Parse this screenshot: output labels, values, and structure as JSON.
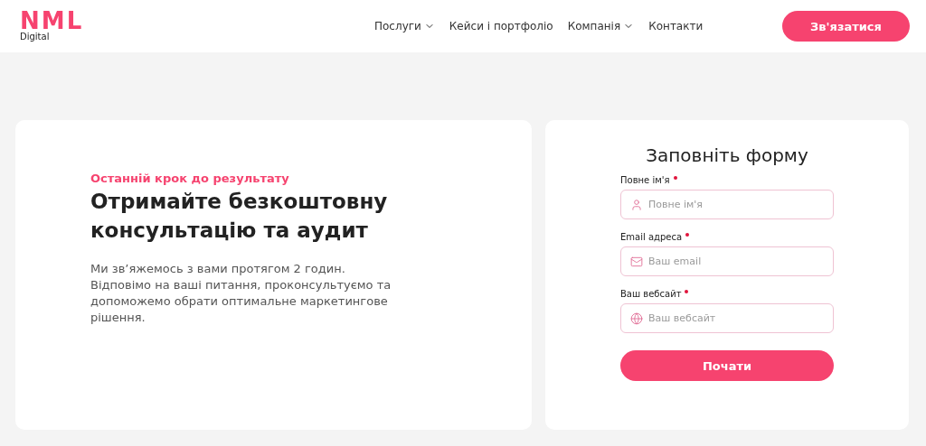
{
  "header": {
    "logo": {
      "mark": "NML",
      "sub": "Digital"
    },
    "nav": [
      {
        "label": "Послуги",
        "dropdown": true
      },
      {
        "label": "Кейси і портфоліо",
        "dropdown": false
      },
      {
        "label": "Компанія",
        "dropdown": true
      },
      {
        "label": "Контакти",
        "dropdown": false
      }
    ],
    "cta": "Зв'язатися"
  },
  "intro": {
    "eyebrow": "Останній крок до результату",
    "title": "Отримайте безкоштовну консультацію та аудит",
    "text": "Ми зв’яжемось з вами протягом 2 годин. Відповімо на ваші питання, проконсультуємо та допоможемо обрати оптимальне маркетингове рішення."
  },
  "form": {
    "title": "Заповніть форму",
    "fields": [
      {
        "kind": "person",
        "label": "Повне ім'я",
        "required": true,
        "placeholder": "Повне ім'я"
      },
      {
        "kind": "email",
        "label": "Email адреса",
        "required": true,
        "placeholder": "Ваш email"
      },
      {
        "kind": "website",
        "label": "Ваш вебсайт",
        "required": true,
        "placeholder": "Ваш вебсайт"
      }
    ],
    "submit": "Почати"
  }
}
